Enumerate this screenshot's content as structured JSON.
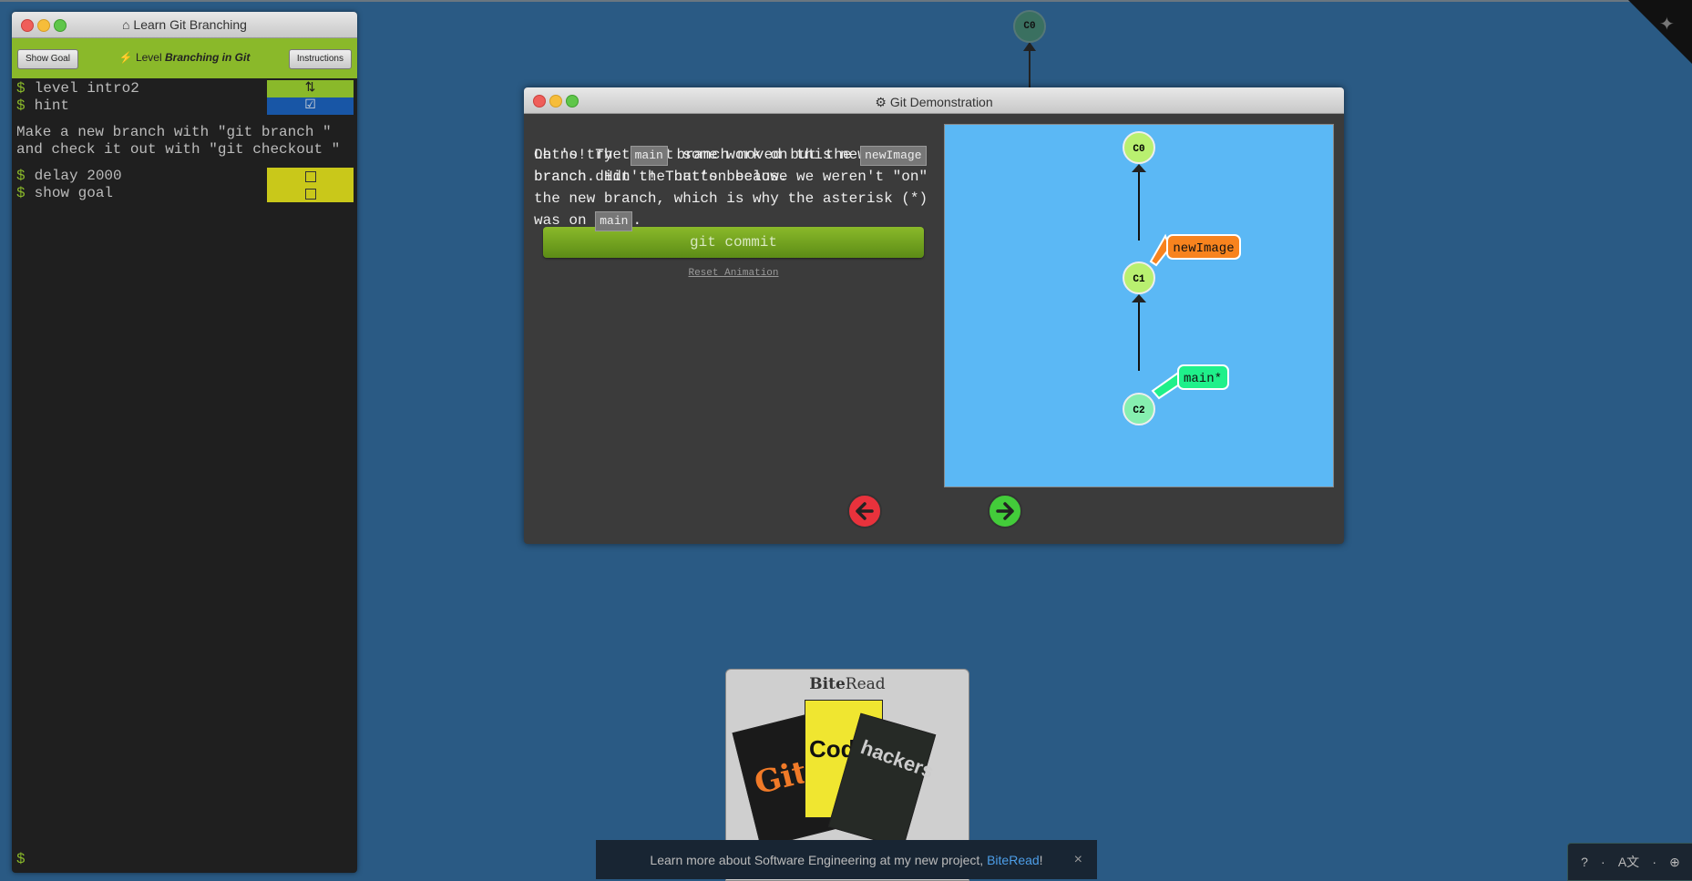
{
  "terminal": {
    "title": "Learn Git Branching",
    "show_goal": "Show Goal",
    "instructions": "Instructions",
    "level_prefix": "Level",
    "level_name": "Branching in Git",
    "commands": [
      {
        "text": "level intro2",
        "status": "⇅"
      },
      {
        "text": "hint",
        "status": "☑"
      }
    ],
    "hint_line1": "Make a new branch with \"git branch \"",
    "hint_line2": "and check it out with \"git checkout \"",
    "more_commands": [
      {
        "text": "delay 2000"
      },
      {
        "text": "show goal"
      }
    ],
    "prompt": "$"
  },
  "background_tree": {
    "node": "C0"
  },
  "modal": {
    "title": "Git Demonstration",
    "intro_line1": "Let's try to put some work on this new",
    "intro_line2": "branch. Hit the button below.",
    "commit_button": "git commit",
    "reset": "Reset Animation",
    "explain": {
      "p1": "Oh no! The",
      "code1": "main",
      "p2": "branch moved but the",
      "code2": "newImage",
      "p3": "branch didn't! That's because we weren't \"on\"",
      "p4": "the new branch, which is why the asterisk (*)",
      "p5": "was on",
      "code3": "main",
      "p6": "."
    },
    "graph": {
      "nodes": [
        "C0",
        "C1",
        "C2"
      ],
      "branch_new": "newImage",
      "branch_main": "main*",
      "colors": {
        "bg": "#5bb8f5",
        "node": "#b9f070",
        "new": "#f8831e",
        "main": "#1ff08a"
      }
    }
  },
  "ad": {
    "brand_bite": "Bite",
    "brand_read": "Read",
    "book1": "Git",
    "book2": "Code",
    "book3": "hackers"
  },
  "banner": {
    "text": "Learn more about Software Engineering at my new project,",
    "link": "BiteRead",
    "suffix": "!",
    "close": "×"
  },
  "helpbar": {
    "items": [
      "?",
      "·",
      "A文",
      "·",
      "⊕"
    ]
  }
}
